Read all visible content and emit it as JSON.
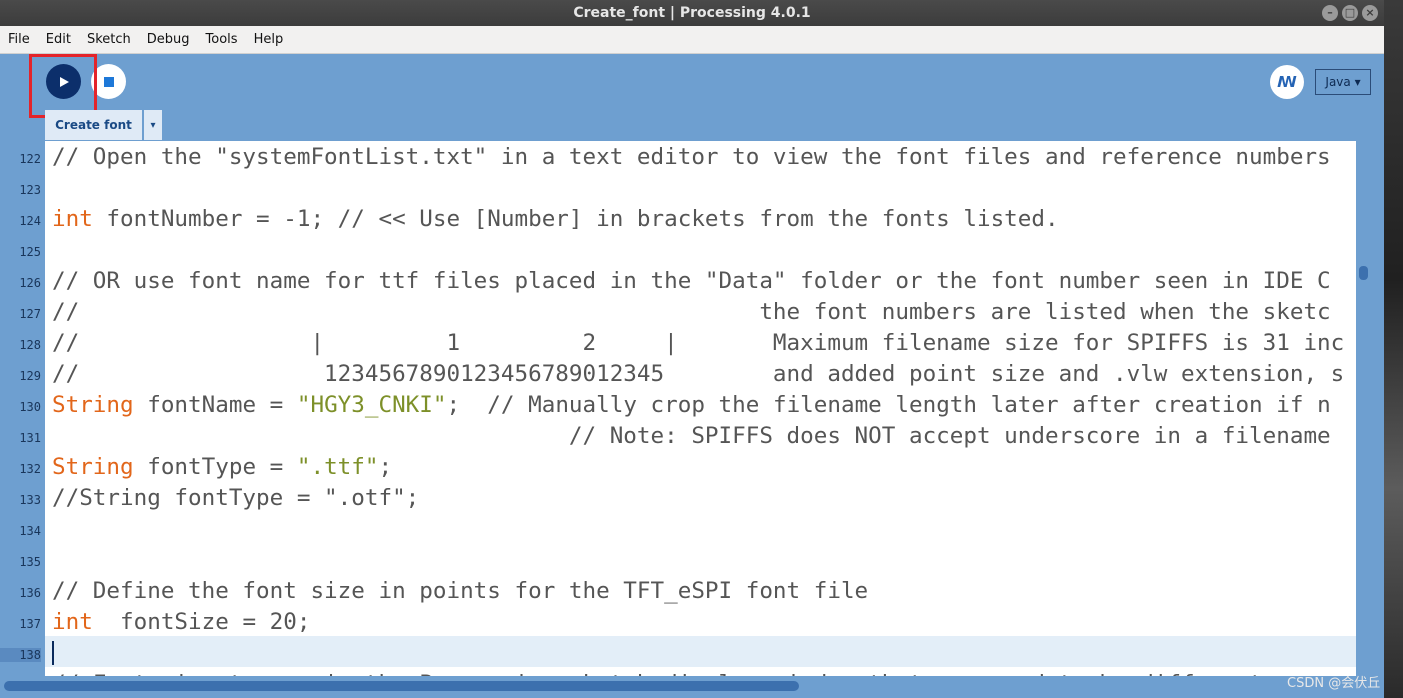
{
  "window": {
    "title": "Create_font | Processing 4.0.1",
    "controls": [
      "–",
      "□",
      "×"
    ]
  },
  "menu": [
    "File",
    "Edit",
    "Sketch",
    "Debug",
    "Tools",
    "Help"
  ],
  "toolbar": {
    "run_icon": "play-icon",
    "stop_icon": "stop-icon",
    "debug_label": "ꟿ",
    "mode_label": "Java ▾"
  },
  "tab": {
    "label": "Create font",
    "arrow": "▾"
  },
  "editor": {
    "current_line": 138,
    "lines": [
      {
        "n": "122",
        "segs": [
          [
            "c",
            "// Open the \"systemFontList.txt\" in a text editor to view the font files and reference numbers"
          ]
        ]
      },
      {
        "n": "123",
        "segs": []
      },
      {
        "n": "124",
        "segs": [
          [
            "k",
            "int"
          ],
          [
            "c",
            " fontNumber = -1; // << Use [Number] in brackets from the fonts listed."
          ]
        ]
      },
      {
        "n": "125",
        "segs": []
      },
      {
        "n": "126",
        "segs": [
          [
            "c",
            "// OR use font name for ttf files placed in the \"Data\" folder or the font number seen in IDE C"
          ]
        ]
      },
      {
        "n": "127",
        "segs": [
          [
            "c",
            "//                                                  the font numbers are listed when the sketc"
          ]
        ]
      },
      {
        "n": "128",
        "segs": [
          [
            "c",
            "//                 |         1         2     |       Maximum filename size for SPIFFS is 31 inc"
          ]
        ]
      },
      {
        "n": "129",
        "segs": [
          [
            "c",
            "//                  1234567890123456789012345        and added point size and .vlw extension, s"
          ]
        ]
      },
      {
        "n": "130",
        "segs": [
          [
            "k",
            "String"
          ],
          [
            "c",
            " fontName = "
          ],
          [
            "s",
            "\"HGY3_CNKI\""
          ],
          [
            "c",
            ";  // Manually crop the filename length later after creation if n"
          ]
        ]
      },
      {
        "n": "131",
        "segs": [
          [
            "c",
            "                                      // Note: SPIFFS does NOT accept underscore in a filename"
          ]
        ]
      },
      {
        "n": "132",
        "segs": [
          [
            "k",
            "String"
          ],
          [
            "c",
            " fontType = "
          ],
          [
            "s",
            "\".ttf\""
          ],
          [
            "c",
            ";"
          ]
        ]
      },
      {
        "n": "133",
        "segs": [
          [
            "c",
            "//String fontType = \".otf\";"
          ]
        ]
      },
      {
        "n": "134",
        "segs": []
      },
      {
        "n": "135",
        "segs": []
      },
      {
        "n": "136",
        "segs": [
          [
            "c",
            "// Define the font size in points for the TFT_eSPI font file"
          ]
        ]
      },
      {
        "n": "137",
        "segs": [
          [
            "k",
            "int"
          ],
          [
            "c",
            "  fontSize = 20;"
          ]
        ]
      },
      {
        "n": "138",
        "segs": []
      },
      {
        "n": "",
        "segs": [
          [
            "c",
            "// Font size to use in the Processing sketch display window that may need to be different"
          ]
        ]
      }
    ]
  },
  "watermark": "CSDN @会伏丘"
}
